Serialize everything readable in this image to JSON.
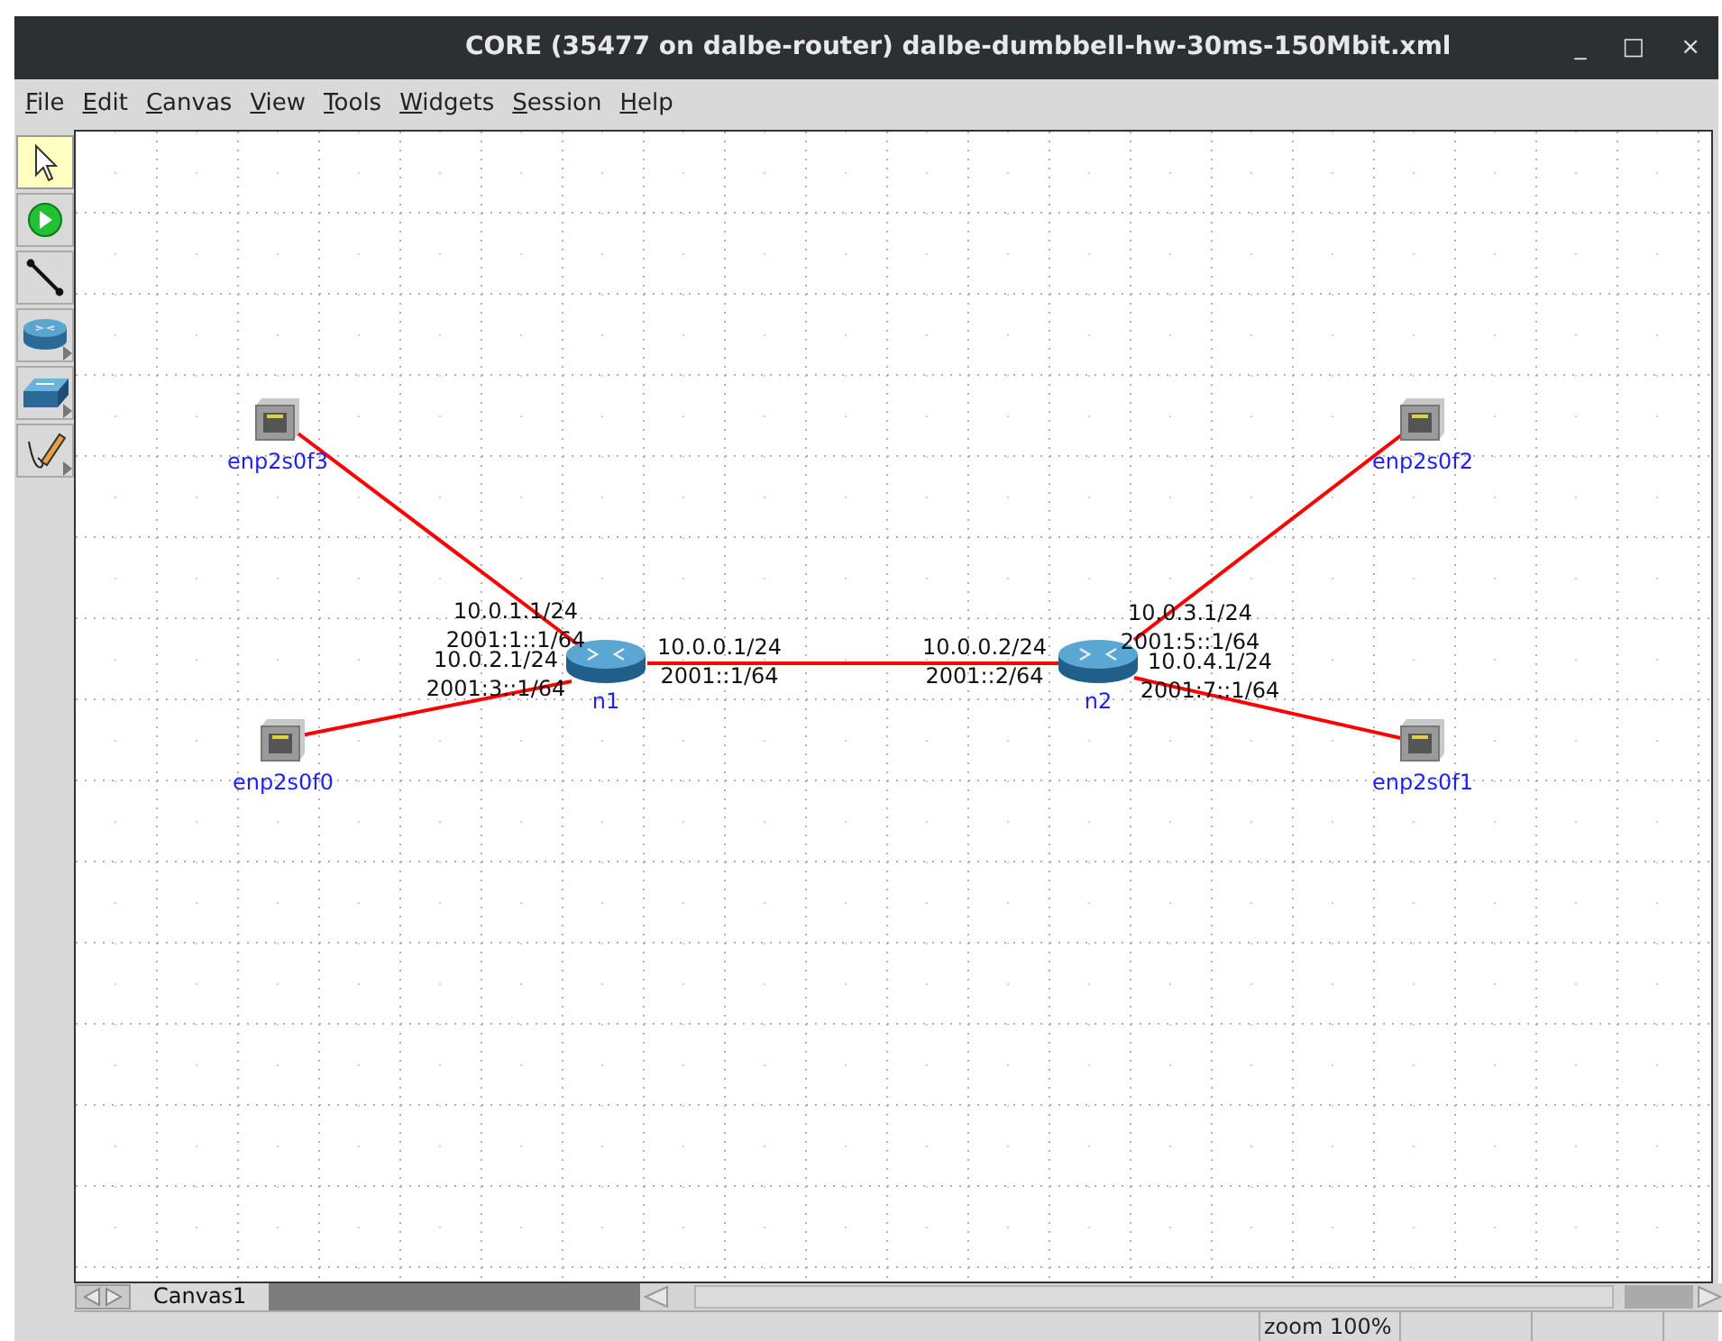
{
  "window": {
    "title": "CORE (35477 on dalbe-router) dalbe-dumbbell-hw-30ms-150Mbit.xml",
    "controls": [
      "_",
      "□",
      "×"
    ]
  },
  "menu": [
    "File",
    "Edit",
    "Canvas",
    "View",
    "Tools",
    "Widgets",
    "Session",
    "Help"
  ],
  "tools": [
    {
      "kind": "select",
      "selected": true,
      "has_menu": false
    },
    {
      "kind": "start",
      "selected": false,
      "has_menu": false
    },
    {
      "kind": "link",
      "selected": false,
      "has_menu": false
    },
    {
      "kind": "router",
      "selected": false,
      "has_menu": true
    },
    {
      "kind": "switch",
      "selected": false,
      "has_menu": true
    },
    {
      "kind": "annotate",
      "selected": false,
      "has_menu": true
    }
  ],
  "nodes": [
    {
      "kind": "ethernet",
      "label": "enp2s0f3"
    },
    {
      "kind": "ethernet",
      "label": "enp2s0f0"
    },
    {
      "kind": "router",
      "label": "n1"
    },
    {
      "kind": "router",
      "label": "n2"
    },
    {
      "kind": "ethernet",
      "label": "enp2s0f2"
    },
    {
      "kind": "ethernet",
      "label": "enp2s0f1"
    }
  ],
  "links": [
    {
      "labels": [
        [
          "10.0.0.1/24",
          "2001::1/64"
        ],
        [
          "10.0.0.2/24",
          "2001::2/64"
        ]
      ]
    },
    {
      "labels": [
        [
          "10.0.1.1/24",
          "2001:1::1/64"
        ]
      ]
    },
    {
      "labels": [
        [
          "10.0.2.1/24",
          "2001:3::1/64"
        ]
      ]
    },
    {
      "labels": [
        [
          "10.0.3.1/24",
          "2001:5::1/64"
        ]
      ]
    },
    {
      "labels": [
        [
          "10.0.4.1/24",
          "2001:7::1/64"
        ]
      ]
    }
  ],
  "canvas_tabs": [
    {
      "label": "Canvas1",
      "selected": true
    }
  ],
  "status_bar": {
    "zoom": "zoom 100%"
  }
}
